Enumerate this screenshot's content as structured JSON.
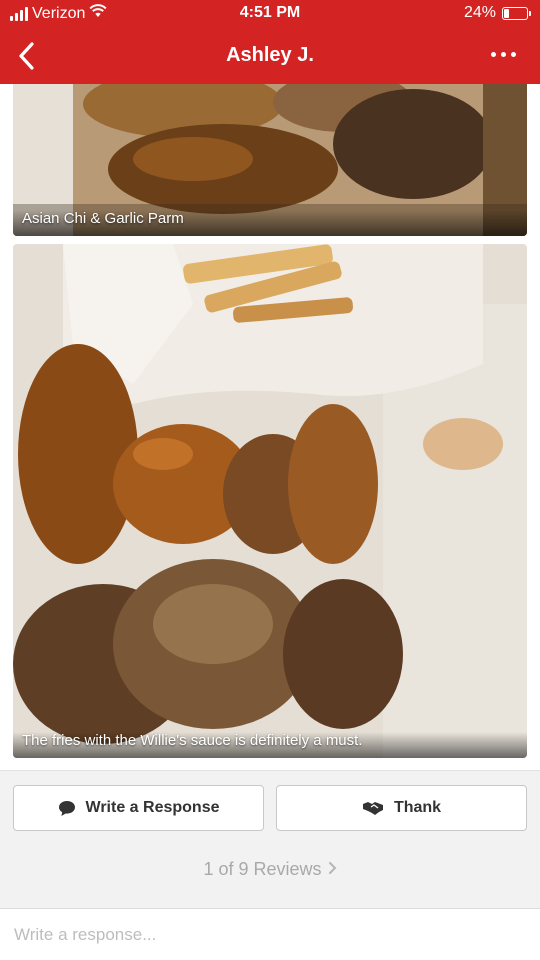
{
  "status_bar": {
    "carrier": "Verizon",
    "time": "4:51 PM",
    "battery": "24%",
    "battery_level": 0.24,
    "icons": [
      "signal-icon",
      "wifi-icon",
      "battery-icon"
    ]
  },
  "nav": {
    "title": "Ashley J.",
    "back_icon": "back-chevron-icon",
    "more_icon": "more-dots-icon"
  },
  "photos": [
    {
      "caption": "Asian Chi & Garlic Parm"
    },
    {
      "caption": "The fries with the Willie's sauce is definitely a must."
    }
  ],
  "actions": {
    "write_label": "Write a Response",
    "write_icon": "speech-bubble-icon",
    "thank_label": "Thank",
    "thank_icon": "handshake-icon"
  },
  "pager": {
    "label": "1 of 9 Reviews",
    "icon": "chevron-right-icon"
  },
  "composer": {
    "placeholder": "Write a response..."
  },
  "colors": {
    "brand": "#d32323",
    "background": "#f2f2f2",
    "pager_text": "#a9a9a9"
  }
}
